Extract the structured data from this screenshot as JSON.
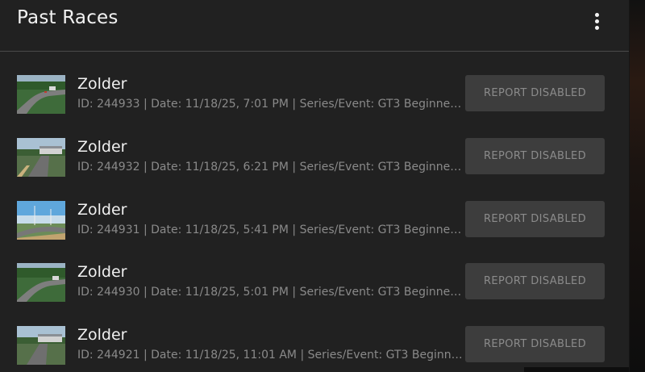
{
  "page": {
    "title": "Past Races",
    "menu_icon": "more-vertical-icon"
  },
  "races": [
    {
      "track": "Zolder",
      "details": "ID: 244933 | Date: 11/18/25, 7:01 PM | Series/Event: GT3 Beginners ...",
      "button_label": "REPORT DISABLED",
      "thumbnail": "track-thumbnail-aerial"
    },
    {
      "track": "Zolder",
      "details": "ID: 244932 | Date: 11/18/25, 6:21 PM | Series/Event: GT3 Beginners ...",
      "button_label": "REPORT DISABLED",
      "thumbnail": "track-thumbnail-grandstand"
    },
    {
      "track": "Zolder",
      "details": "ID: 244931 | Date: 11/18/25, 5:41 PM | Series/Event: GT3 Beginners S...",
      "button_label": "REPORT DISABLED",
      "thumbnail": "track-thumbnail-sky"
    },
    {
      "track": "Zolder",
      "details": "ID: 244930 | Date: 11/18/25, 5:01 PM | Series/Event: GT3 Beginners ...",
      "button_label": "REPORT DISABLED",
      "thumbnail": "track-thumbnail-aerial"
    },
    {
      "track": "Zolder",
      "details": "ID: 244921 | Date: 11/18/25, 11:01 AM | Series/Event: GT3 Beginners ...",
      "button_label": "REPORT DISABLED",
      "thumbnail": "track-thumbnail-grandstand"
    }
  ],
  "colors": {
    "panel_bg": "#212121",
    "button_bg": "#3d3d3d",
    "text_primary": "#f0f0f0",
    "text_secondary": "#8a8a8a"
  }
}
